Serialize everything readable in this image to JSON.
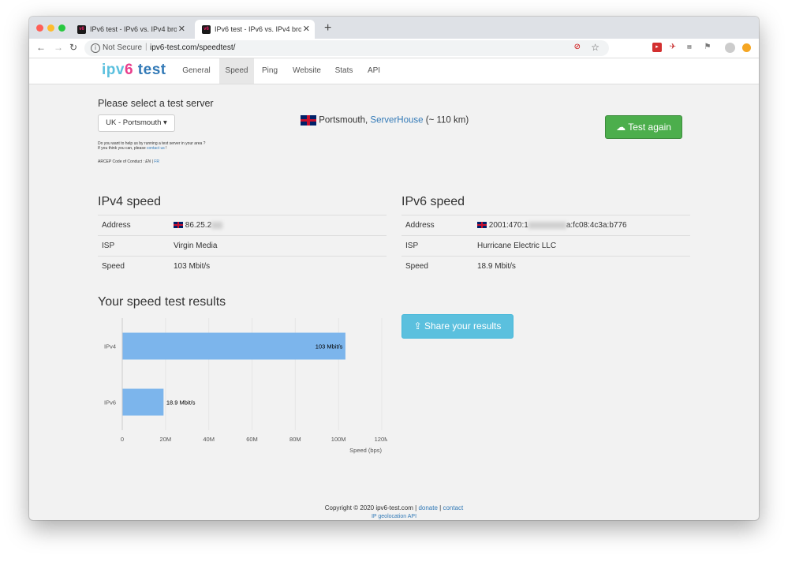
{
  "browser": {
    "tabs": [
      {
        "title": "IPv6 test - IPv6 vs. IPv4 broadband",
        "favicon": "v6",
        "active": false
      },
      {
        "title": "IPv6 test - IPv6 vs. IPv4 broadband",
        "favicon": "v6",
        "active": true
      }
    ],
    "security": "Not Secure",
    "url": "ipv6-test.com/speedtest/"
  },
  "site": {
    "logo": {
      "part1": "ipv",
      "part2": "6",
      "part3": " test"
    },
    "nav": [
      "General",
      "Speed",
      "Ping",
      "Website",
      "Stats",
      "API"
    ],
    "active_nav": "Speed"
  },
  "server_select": {
    "heading": "Please select a test server",
    "selected": "UK - Portsmouth",
    "help_line1": "Do you want to help us by running a test server in your area ?",
    "help_line2_prefix": "If you think you can, please",
    "help_link": "contact us",
    "help_suffix": "!",
    "arcep_prefix": "ARCEP Code of Conduct :",
    "arcep_en": "EN",
    "arcep_sep": "|",
    "arcep_fr": "FR"
  },
  "server_info": {
    "city": "Portsmouth,",
    "host": "ServerHouse",
    "distance": "(~ 110 km)",
    "flag_label": "GB"
  },
  "test_again": "Test again",
  "ipv4": {
    "title": "IPv4 speed",
    "rows": [
      {
        "key": "Address",
        "value": "86.25.2",
        "flag": true
      },
      {
        "key": "ISP",
        "value": "Virgin Media"
      },
      {
        "key": "Speed",
        "value": "103 Mbit/s"
      }
    ]
  },
  "ipv6": {
    "title": "IPv6 speed",
    "rows": [
      {
        "key": "Address",
        "value_prefix": "2001:470:1",
        "value_suffix": "a:fc08:4c3a:b776",
        "flag": true
      },
      {
        "key": "ISP",
        "value": "Hurricane Electric LLC"
      },
      {
        "key": "Speed",
        "value": "18.9 Mbit/s"
      }
    ]
  },
  "results_title": "Your speed test results",
  "share_button": "Share your results",
  "chart_data": {
    "type": "bar",
    "orientation": "horizontal",
    "categories": [
      "IPv4",
      "IPv6"
    ],
    "values": [
      103,
      18.9
    ],
    "value_unit": "M",
    "data_labels": [
      "103 Mbit/s",
      "18.9 Mbit/s"
    ],
    "xlabel": "Speed (bps)",
    "xlim": [
      0,
      120
    ],
    "xticks": [
      "0",
      "20M",
      "40M",
      "60M",
      "80M",
      "100M",
      "120M"
    ],
    "grid": true,
    "bar_color": "#7cb5ec"
  },
  "footer": {
    "copyright": "Copyright © 2020 ipv6-test.com",
    "sep": "|",
    "donate": "donate",
    "contact": "contact",
    "api": "IP geolocation API"
  },
  "colors": {
    "green_button": "#4cae4c",
    "blue_button": "#5bc0de",
    "link": "#337ab7"
  }
}
